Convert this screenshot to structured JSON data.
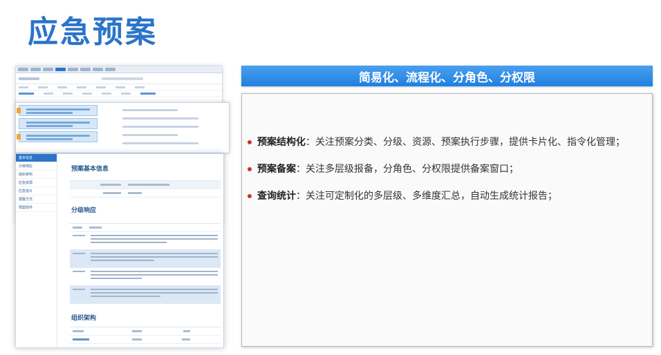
{
  "slide": {
    "title": "应急预案"
  },
  "panel": {
    "header": "简易化、流程化、分角色、分权限",
    "bullets": [
      {
        "key": "预案结构化",
        "sep": "：",
        "text": "关注预案分类、分级、资源、预案执行步骤，提供卡片化、指令化管理；"
      },
      {
        "key": "预案备案",
        "sep": "：",
        "text": "关注多层级报备，分角色、分权限提供备案窗口；"
      },
      {
        "key": "查询统计",
        "sep": "：",
        "text": "关注可定制化的多层级、多维度汇总，自动生成统计报告；"
      }
    ]
  },
  "screenshot": {
    "sidebar_items": [
      "基本信息",
      "分级响应",
      "组织架构",
      "应急资源",
      "应急指令",
      "报警方式",
      "预案附件"
    ],
    "section_basic": "预案基本信息",
    "section_level": "分级响应",
    "section_org": "组织架构"
  },
  "colors": {
    "title": "#2b74c9",
    "header_bar": "#2d8be6",
    "bullet_dot": "#c0392b"
  }
}
